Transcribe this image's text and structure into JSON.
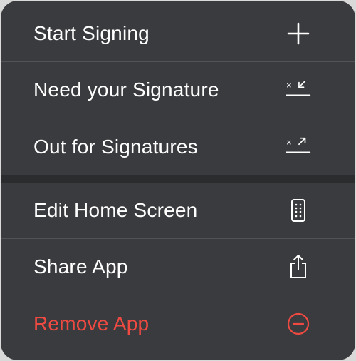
{
  "menu": {
    "group1": [
      {
        "label": "Start Signing",
        "icon": "plus-icon"
      },
      {
        "label": "Need your Signature",
        "icon": "signature-incoming-icon"
      },
      {
        "label": "Out for Signatures",
        "icon": "signature-outgoing-icon"
      }
    ],
    "group2": [
      {
        "label": "Edit Home Screen",
        "icon": "phone-apps-icon"
      },
      {
        "label": "Share App",
        "icon": "share-icon"
      },
      {
        "label": "Remove App",
        "icon": "minus-circle-icon",
        "destructive": true
      }
    ]
  },
  "colors": {
    "background": "#3a3b3e",
    "text": "#ffffff",
    "destructive": "#ef4a42",
    "divider": "#525356",
    "group_separator": "#2b2c2e"
  }
}
